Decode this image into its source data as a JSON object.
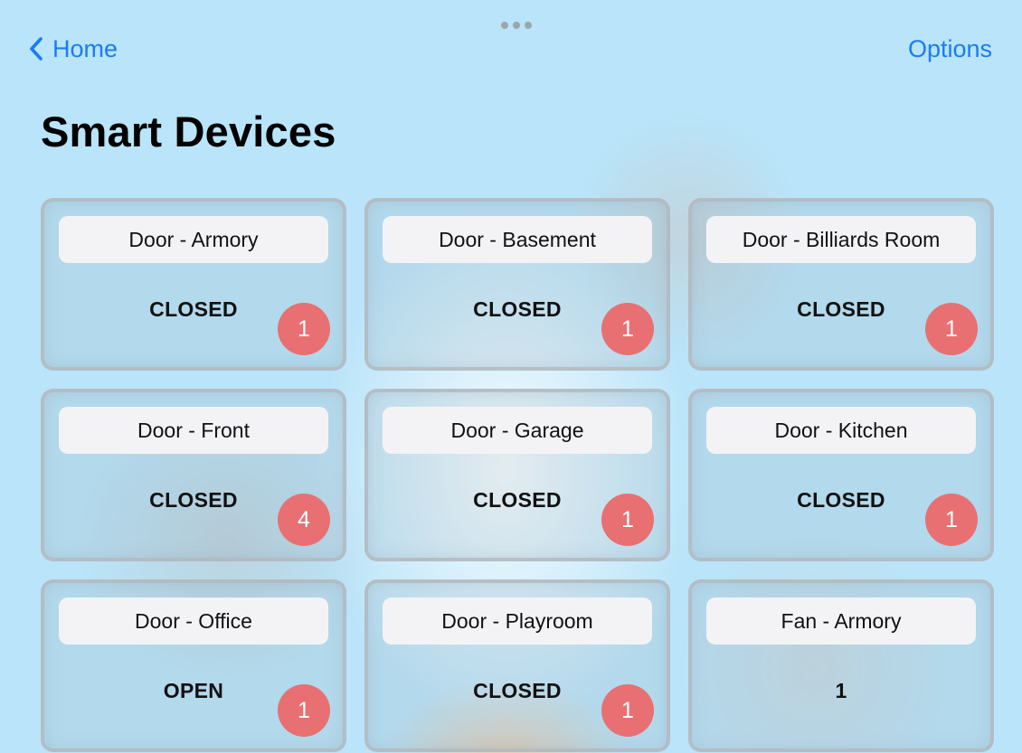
{
  "nav": {
    "back_icon": "chevron-left-icon",
    "back_label": "Home",
    "options_label": "Options",
    "grabber_icon": "more-dots-icon"
  },
  "page": {
    "title": "Smart Devices"
  },
  "colors": {
    "accent": "#1a7cf5",
    "badge": "#e87072",
    "background": "#b9e4f9"
  },
  "devices": [
    {
      "name": "Door - Armory",
      "status": "CLOSED",
      "badge": "1"
    },
    {
      "name": "Door - Basement",
      "status": "CLOSED",
      "badge": "1"
    },
    {
      "name": "Door - Billiards Room",
      "status": "CLOSED",
      "badge": "1"
    },
    {
      "name": "Door - Front",
      "status": "CLOSED",
      "badge": "4"
    },
    {
      "name": "Door - Garage",
      "status": "CLOSED",
      "badge": "1"
    },
    {
      "name": "Door - Kitchen",
      "status": "CLOSED",
      "badge": "1"
    },
    {
      "name": "Door - Office",
      "status": "OPEN",
      "badge": "1"
    },
    {
      "name": "Door - Playroom",
      "status": "CLOSED",
      "badge": "1"
    },
    {
      "name": "Fan - Armory",
      "status": "1",
      "badge": null
    }
  ]
}
